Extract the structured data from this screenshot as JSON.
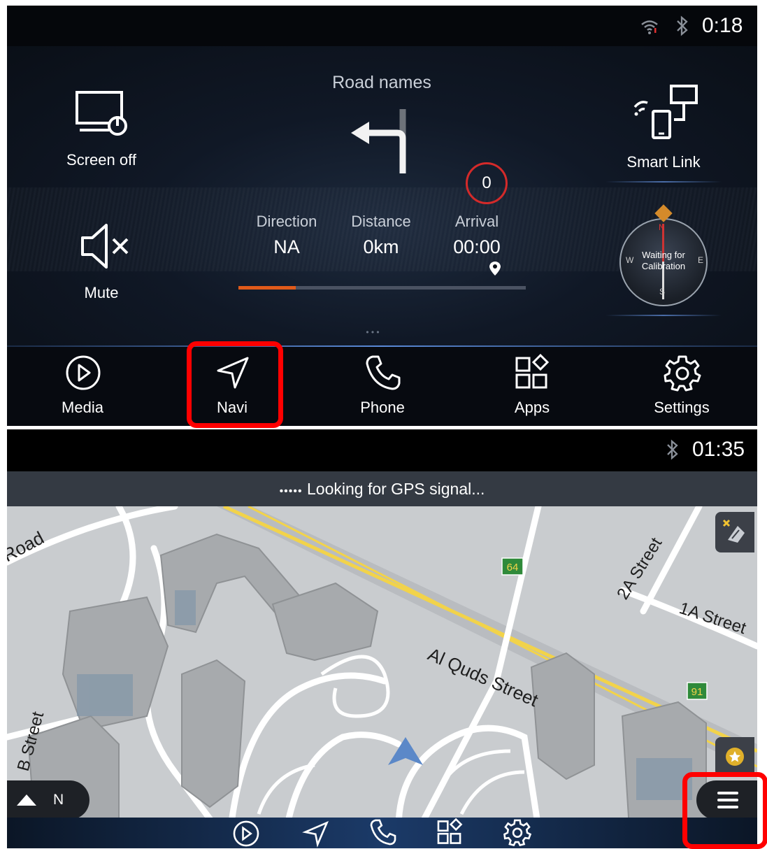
{
  "top": {
    "status": {
      "time": "0:18"
    },
    "screen_off": {
      "label": "Screen off"
    },
    "mute": {
      "label": "Mute"
    },
    "smart_link": {
      "label": "Smart Link"
    },
    "nav_widget": {
      "road_names": "Road names",
      "speed": "0",
      "direction_label": "Direction",
      "direction_value": "NA",
      "distance_label": "Distance",
      "distance_value": "0km",
      "arrival_label": "Arrival",
      "arrival_value": "00:00",
      "progress": 0.2
    },
    "compass": {
      "text_line1": "Waiting for",
      "text_line2": "Calibration",
      "n": "N",
      "s": "S",
      "e": "E",
      "w": "W"
    },
    "dock": [
      {
        "label": "Media",
        "icon": "play-icon"
      },
      {
        "label": "Navi",
        "icon": "navigation-icon"
      },
      {
        "label": "Phone",
        "icon": "phone-icon"
      },
      {
        "label": "Apps",
        "icon": "apps-icon"
      },
      {
        "label": "Settings",
        "icon": "gear-icon"
      }
    ]
  },
  "bottom": {
    "status": {
      "time": "01:35"
    },
    "gps_message": "Looking for GPS signal...",
    "gps_dots": "•••••",
    "streets": {
      "al_quds": "Al Quds Street",
      "road": "Road",
      "street_2a": "2A Street",
      "street_1a": "1A Street",
      "street_b": "B Street"
    },
    "route_shields": {
      "r64": "64",
      "r91": "91"
    },
    "orientation": "N",
    "dock": [
      "play-icon",
      "navigation-icon",
      "phone-icon",
      "apps-icon",
      "gear-icon"
    ]
  },
  "colors": {
    "highlight": "#ff0000",
    "progress": "#e05a1a",
    "accent": "#3a78d0",
    "map_bg": "#c9cccf",
    "road": "#ffffff",
    "highway": "#f2d34a"
  }
}
